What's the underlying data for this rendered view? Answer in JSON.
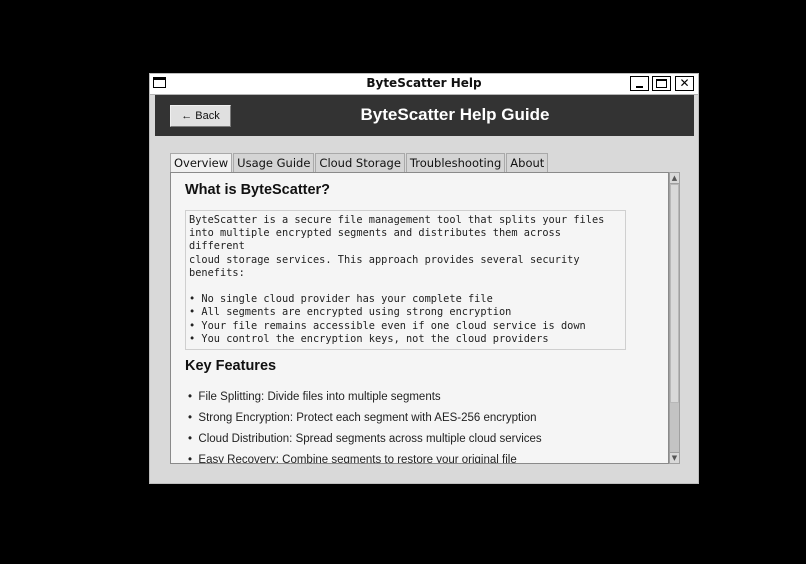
{
  "window": {
    "title": "ByteScatter Help",
    "controls": {
      "minimize": "_",
      "maximize": "□",
      "close": "✕"
    }
  },
  "header": {
    "back_label": "← Back",
    "title": "ByteScatter Help Guide"
  },
  "tabs": [
    {
      "label": "Overview",
      "active": true
    },
    {
      "label": "Usage Guide",
      "active": false
    },
    {
      "label": "Cloud Storage",
      "active": false
    },
    {
      "label": "Troubleshooting",
      "active": false
    },
    {
      "label": "About",
      "active": false
    }
  ],
  "overview": {
    "heading": "What is ByteScatter?",
    "description": "ByteScatter is a secure file management tool that splits your files\ninto multiple encrypted segments and distributes them across different\ncloud storage services. This approach provides several security\nbenefits:\n\n• No single cloud provider has your complete file\n• All segments are encrypted using strong encryption\n• Your file remains accessible even if one cloud service is down\n• You control the encryption keys, not the cloud providers",
    "features_heading": "Key Features",
    "features": [
      "File Splitting: Divide files into multiple segments",
      "Strong Encryption: Protect each segment with AES-256 encryption",
      "Cloud Distribution: Spread segments across multiple cloud services",
      "Easy Recovery: Combine segments to restore your original file"
    ]
  },
  "scrollbar": {
    "up_icon": "▲",
    "down_icon": "▼"
  },
  "colors": {
    "header_bg": "#333333",
    "content_bg": "#f5f5f5",
    "window_bg": "#d9d9d9"
  }
}
